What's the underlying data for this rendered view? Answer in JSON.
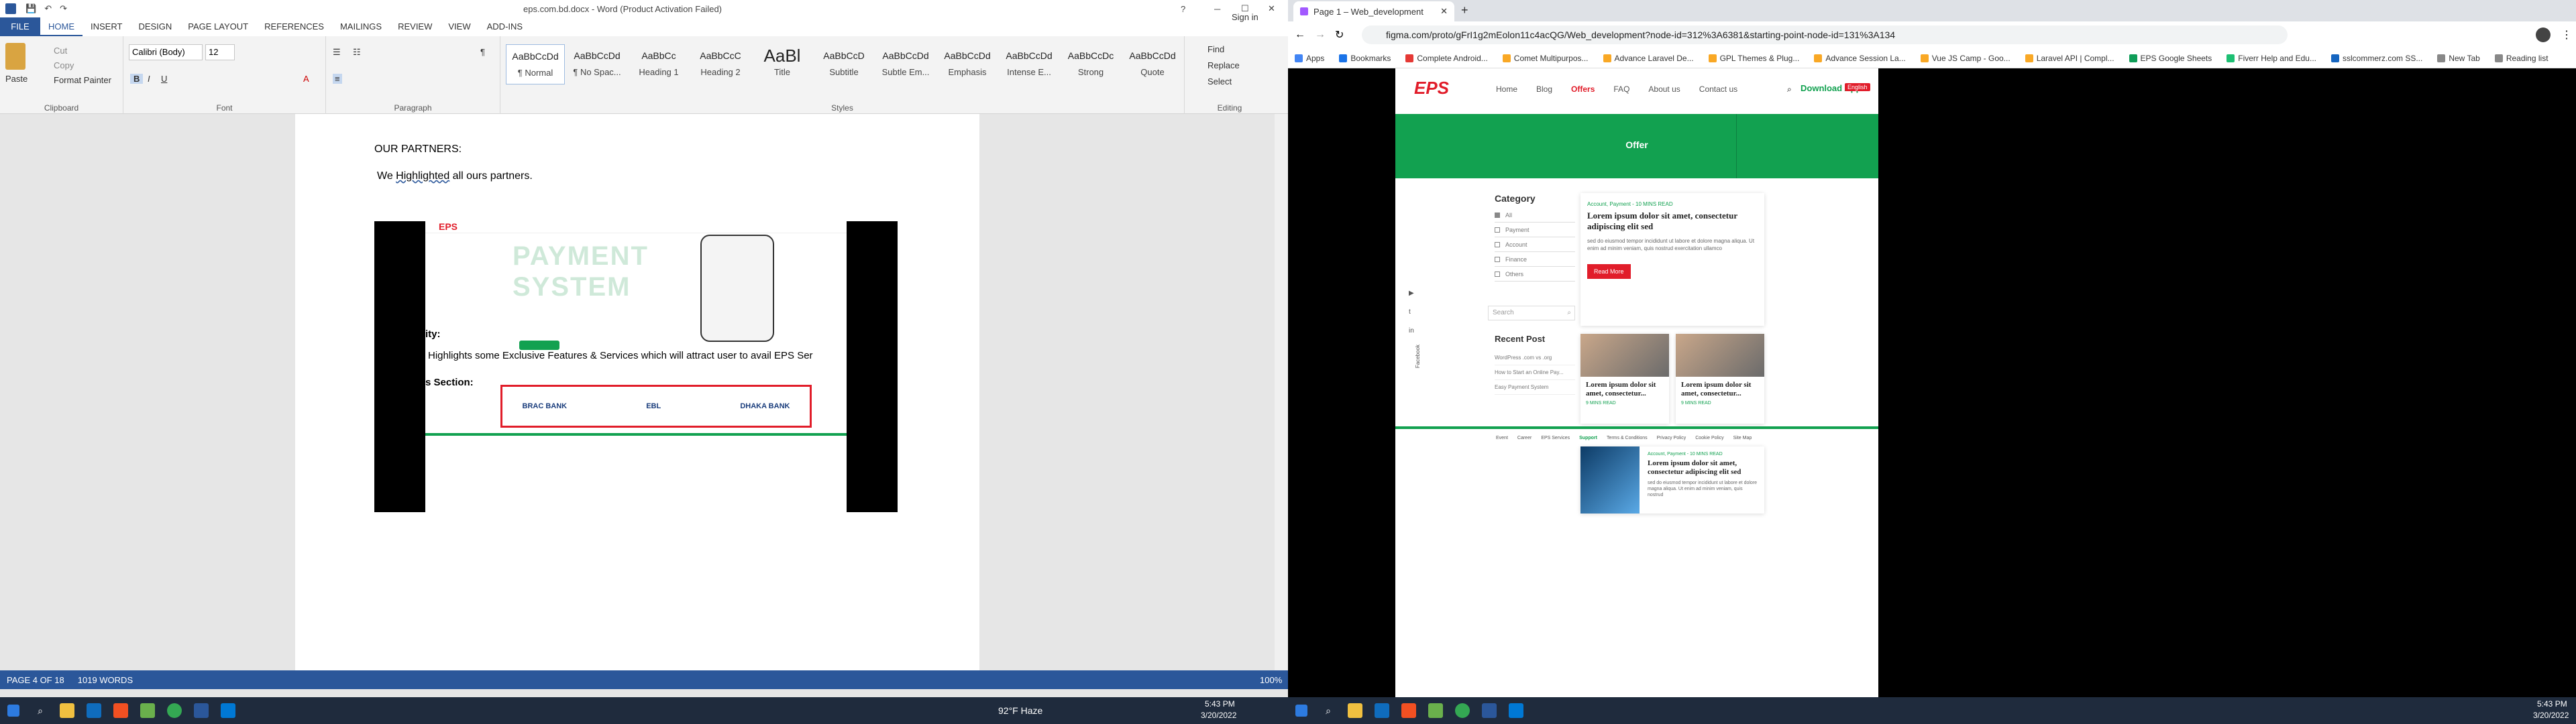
{
  "word": {
    "title": "eps.com.bd.docx - Word (Product Activation Failed)",
    "sign_in": "Sign in",
    "tabs": [
      "FILE",
      "HOME",
      "INSERT",
      "DESIGN",
      "PAGE LAYOUT",
      "REFERENCES",
      "MAILINGS",
      "REVIEW",
      "VIEW",
      "ADD-INS"
    ],
    "clipboard": {
      "paste": "Paste",
      "cut": "Cut",
      "copy": "Copy",
      "format_painter": "Format Painter",
      "label": "Clipboard"
    },
    "font": {
      "name": "Calibri (Body)",
      "size": "12",
      "label": "Font"
    },
    "paragraph_label": "Paragraph",
    "styles_label": "Styles",
    "styles": [
      {
        "preview": "AaBbCcDd",
        "name": "¶ Normal"
      },
      {
        "preview": "AaBbCcDd",
        "name": "¶ No Spac..."
      },
      {
        "preview": "AaBbCc",
        "name": "Heading 1"
      },
      {
        "preview": "AaBbCcC",
        "name": "Heading 2"
      },
      {
        "preview": "AaBl",
        "name": "Title"
      },
      {
        "preview": "AaBbCcD",
        "name": "Subtitle"
      },
      {
        "preview": "AaBbCcDd",
        "name": "Subtle Em..."
      },
      {
        "preview": "AaBbCcDd",
        "name": "Emphasis"
      },
      {
        "preview": "AaBbCcDd",
        "name": "Intense E..."
      },
      {
        "preview": "AaBbCcDc",
        "name": "Strong"
      },
      {
        "preview": "AaBbCcDd",
        "name": "Quote"
      }
    ],
    "editing": {
      "find": "Find",
      "replace": "Replace",
      "select": "Select",
      "label": "Editing"
    },
    "doc": {
      "heading": "OUR PARTNERS:",
      "line_prefix": "We ",
      "line_highlight": "Highlighted",
      "line_suffix": " all ours partners.",
      "embedded": {
        "big_text_1": "PAYMENT",
        "big_text_2": "SYSTEM",
        "overlay_1": "ity:",
        "overlay_2": "Highlights some Exclusive Features & Services which will attract user to avail EPS Ser",
        "overlay_3": "s Section:",
        "partners": [
          "BRAC BANK",
          "",
          "EBL",
          "",
          "DHAKA BANK"
        ]
      }
    },
    "status": {
      "page": "PAGE 4 OF 18",
      "words": "1019 WORDS",
      "zoom": "100%"
    }
  },
  "chrome": {
    "tab_title": "Page 1 – Web_development",
    "url": "figma.com/proto/gFrI1g2mEolon11c4acQG/Web_development?node-id=312%3A6381&starting-point-node-id=131%3A134",
    "bookmarks": [
      "Apps",
      "Bookmarks",
      "Complete Android...",
      "Comet Multipurpos...",
      "Advance Laravel De...",
      "GPL Themes & Plug...",
      "Advance Session La...",
      "Vue JS Camp - Goo...",
      "Laravel API | Compl...",
      "EPS Google Sheets",
      "Fiverr Help and Edu...",
      "sslcommerz.com SS...",
      "New Tab",
      "Reading list"
    ]
  },
  "site": {
    "logo": "EPS",
    "nav": [
      "Home",
      "Blog",
      "Offers",
      "FAQ",
      "About us",
      "Contact us"
    ],
    "download": "Download App",
    "lang": "English",
    "banner": "Offer",
    "category_title": "Category",
    "categories": [
      "All",
      "Payment",
      "Account",
      "Finance",
      "Others"
    ],
    "search_placeholder": "Search",
    "recent_title": "Recent Post",
    "recent": [
      "WordPress .com vs .org",
      "How to Start an Online Pay...",
      "Easy Payment System"
    ],
    "post1": {
      "meta": "Account, Payment - 10 MINS READ",
      "title": "Lorem ipsum dolor sit amet, consectetur adipiscing elit sed",
      "body": "sed do eiusmod tempor incididunt ut labore et dolore magna aliqua. Ut enim ad minim veniam, quis nostrud exercitation ullamco",
      "button": "Read More"
    },
    "card1": {
      "title": "Lorem ipsum dolor sit amet, consectetur...",
      "meta": "9 MINS READ"
    },
    "card2": {
      "title": "Lorem ipsum dolor sit amet, consectetur...",
      "meta": "9 MINS READ"
    },
    "footer_links": [
      "Event",
      "Career",
      "EPS Services",
      "Support",
      "Terms & Conditions",
      "Privacy Policy",
      "Cookie Policy",
      "Site Map"
    ],
    "post2": {
      "meta": "Account, Payment - 10 MINS READ",
      "title": "Lorem ipsum dolor sit amet, consectetur adipiscing elit sed",
      "body": "sed do eiusmod tempor incididunt ut labore et dolore magna aliqua. Ut enim ad minim veniam, quis nostrud"
    },
    "social_text": "Facebook"
  },
  "taskbar_left": {
    "weather": "92°F Haze",
    "time": "5:43 PM",
    "date": "3/20/2022"
  },
  "taskbar_right": {
    "time": "5:43 PM",
    "date": "3/20/2022"
  },
  "colors": {
    "word_blue": "#2b579a",
    "eps_green": "#12a150",
    "eps_red": "#e11d2a",
    "taskbar": "#1f2b3d"
  }
}
